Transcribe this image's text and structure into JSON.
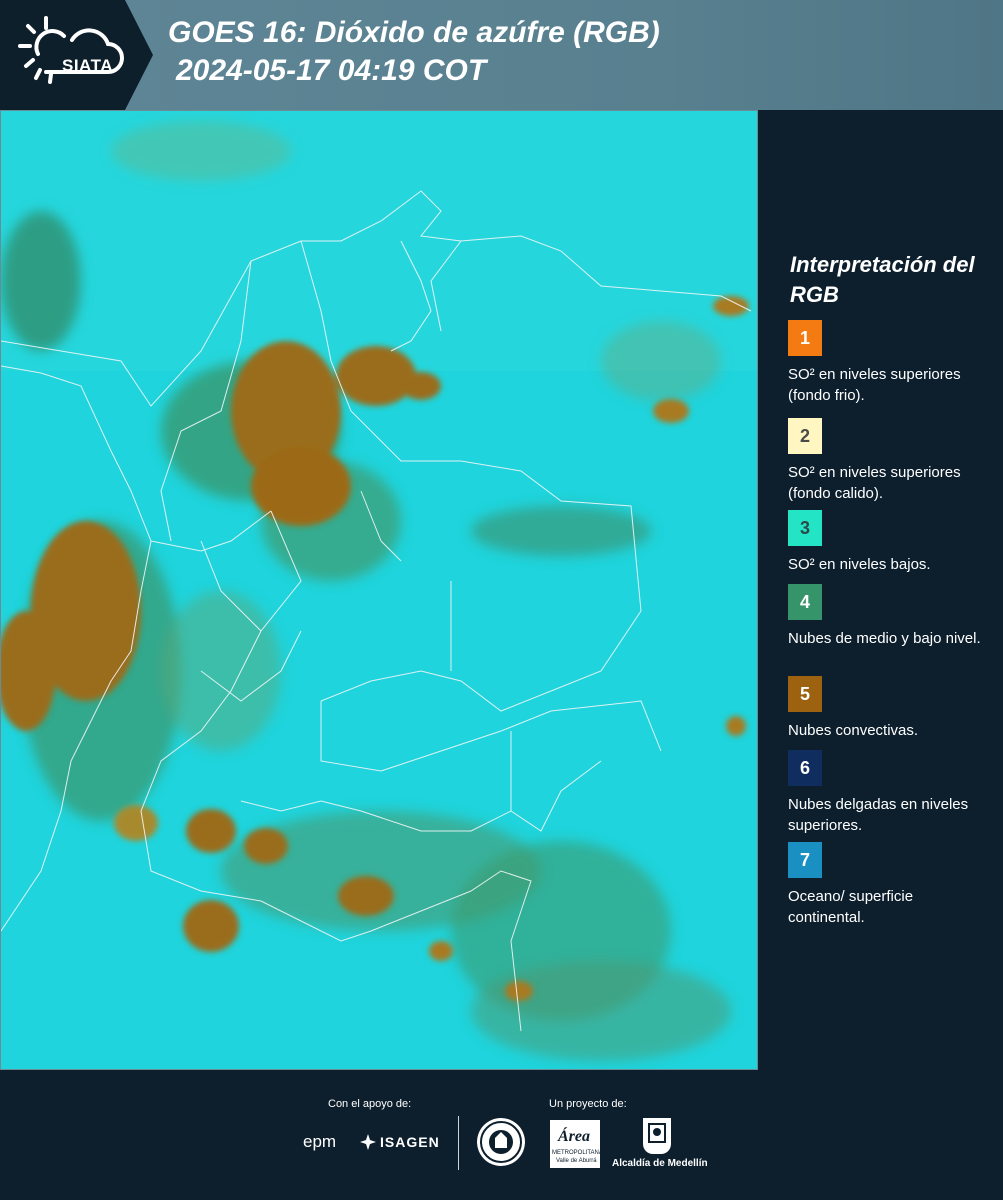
{
  "header": {
    "logo_text": "SIATA",
    "title": "GOES 16: Dióxido de azúfre (RGB)",
    "subtitle": "2024-05-17 04:19 COT"
  },
  "legend": {
    "title": "Interpretación del RGB",
    "items": [
      {
        "number": "1",
        "label": "SO² en niveles superiores (fondo frio).",
        "color": "#f47b12",
        "text_color": "#ffffff"
      },
      {
        "number": "2",
        "label": "SO² en niveles superiores (fondo calido).",
        "color": "#fff6c2",
        "text_color": "#4a4a4a"
      },
      {
        "number": "3",
        "label": "SO² en niveles bajos.",
        "color": "#23e5c6",
        "text_color": "#2a4a4a"
      },
      {
        "number": "4",
        "label": "Nubes de medio y bajo nivel.",
        "color": "#35946a",
        "text_color": "#ffffff"
      },
      {
        "number": "5",
        "label": "Nubes convectivas.",
        "color": "#9c6210",
        "text_color": "#ffffff"
      },
      {
        "number": "6",
        "label": "Nubes delgadas en niveles superiores.",
        "color": "#0f2d5e",
        "text_color": "#ffffff"
      },
      {
        "number": "7",
        "label": "Oceano/ superficie continental.",
        "color": "#1a8fc2",
        "text_color": "#ffffff"
      }
    ]
  },
  "footer": {
    "support_label": "Con el apoyo de:",
    "project_label": "Un proyecto de:",
    "logos": {
      "epm": "epm",
      "isagen": "ISAGEN",
      "area_main": "Área",
      "area_sub1": "METROPOLITANA",
      "area_sub2": "Valle de Aburrá",
      "alcaldia": "Alcaldía de Medellín"
    }
  },
  "colors": {
    "background": "#0d1f2d",
    "header_band": "#5a8292",
    "map_base": "#1fd6dc",
    "cloud_green": "#3e9a6e",
    "cloud_brown": "#9a6d1a"
  }
}
